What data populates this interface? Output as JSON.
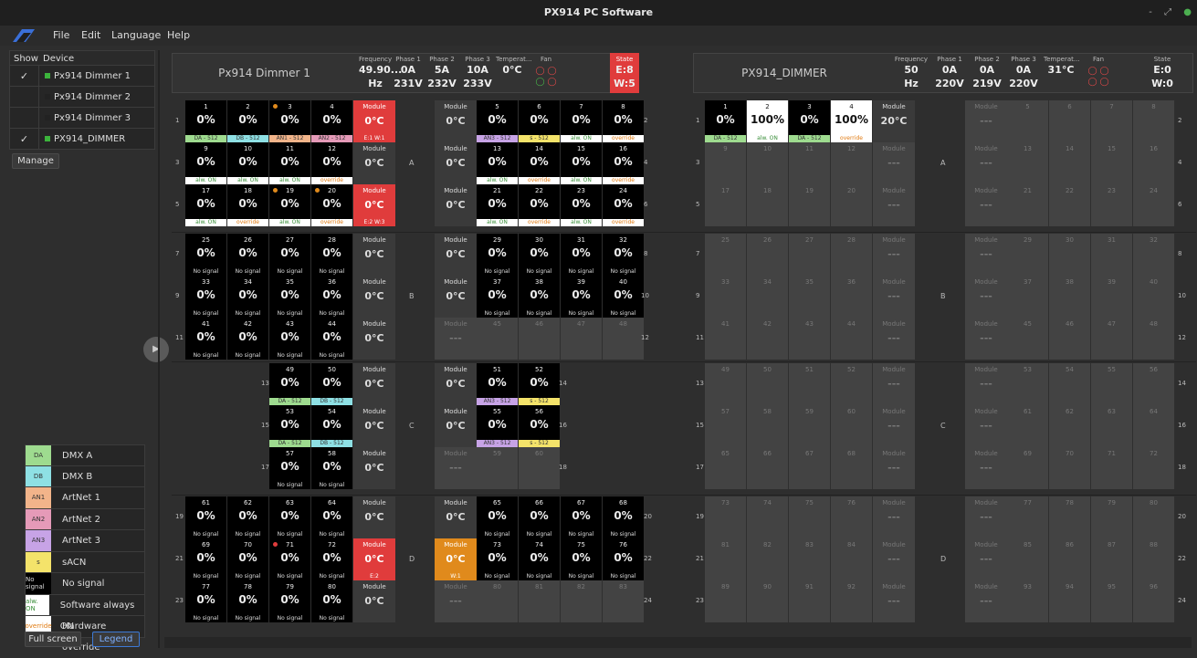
{
  "window": {
    "title": "PX914 PC Software",
    "controls": [
      "-",
      "⤢",
      "●"
    ]
  },
  "menu": [
    "File",
    "Edit",
    "Language",
    "Help"
  ],
  "devices": {
    "header_show": "Show",
    "header_device": "Device",
    "items": [
      {
        "checked": true,
        "name": "Px914 Dimmer 1",
        "color": "#3cb43c"
      },
      {
        "checked": false,
        "name": "Px914 Dimmer 2",
        "color": "#222222"
      },
      {
        "checked": false,
        "name": "Px914 Dimmer 3",
        "color": "#222222"
      },
      {
        "checked": true,
        "name": "PX914_DIMMER",
        "color": "#3cb43c"
      }
    ],
    "manage": "Manage"
  },
  "legend": [
    {
      "code": "DA",
      "label": "DMX A",
      "color": "#9edb8f",
      "text": "#333"
    },
    {
      "code": "DB",
      "label": "DMX B",
      "color": "#8ee0e4",
      "text": "#333"
    },
    {
      "code": "AN1",
      "label": "ArtNet 1",
      "color": "#f2b48a",
      "text": "#333"
    },
    {
      "code": "AN2",
      "label": "ArtNet 2",
      "color": "#e59ab8",
      "text": "#333"
    },
    {
      "code": "AN3",
      "label": "ArtNet 3",
      "color": "#c7a3e6",
      "text": "#333"
    },
    {
      "code": "s",
      "label": "sACN",
      "color": "#f4e36a",
      "text": "#333"
    },
    {
      "code": "No signal",
      "label": "No signal",
      "color": "#000000",
      "text": "#ddd"
    },
    {
      "code": "alw. ON",
      "label": "Software always ON",
      "color": "#ffffff",
      "text": "#3a8f3a"
    },
    {
      "code": "override",
      "label": "Hardware override",
      "color": "#ffffff",
      "text": "#e07a10"
    }
  ],
  "buttons": {
    "fullscreen": "Full screen",
    "legend": "Legend"
  },
  "tags": {
    "DA": {
      "text": "DA - 512",
      "bg": "#9edb8f",
      "fg": "#333"
    },
    "DB": {
      "text": "DB - 512",
      "bg": "#8ee0e4",
      "fg": "#333"
    },
    "AN1": {
      "text": "AN1 - 512",
      "bg": "#f2b48a",
      "fg": "#333"
    },
    "AN2": {
      "text": "AN2 - 512",
      "bg": "#e59ab8",
      "fg": "#333"
    },
    "AN3": {
      "text": "AN3 - 512",
      "bg": "#c7a3e6",
      "fg": "#333"
    },
    "S": {
      "text": "s - 512",
      "bg": "#f4e36a",
      "fg": "#333"
    },
    "ON": {
      "text": "alw. ON",
      "bg": "#ffffff",
      "fg": "#3a8f3a"
    },
    "OV": {
      "text": "override",
      "bg": "#ffffff",
      "fg": "#e07a10"
    },
    "NS": {
      "text": "No signal",
      "bg": "#000000",
      "fg": "#ddd"
    }
  },
  "header_labels": {
    "freq": "Frequency",
    "p1": "Phase 1",
    "p2": "Phase 2",
    "p3": "Phase 3",
    "temp": "Temperat...",
    "fan": "Fan",
    "state": "State"
  },
  "panels": [
    {
      "name": "Px914 Dimmer 1",
      "freq": [
        "49.90...",
        "Hz"
      ],
      "p1": [
        "0A",
        "231V"
      ],
      "p2": [
        "5A",
        "232V"
      ],
      "p3": [
        "10A",
        "233V"
      ],
      "temp": "0°C",
      "fan": [
        [
          "red",
          "red"
        ],
        [
          "green",
          "red"
        ]
      ],
      "state": [
        "E:8",
        "W:5"
      ],
      "state_fail": true
    },
    {
      "name": "PX914_DIMMER",
      "freq": [
        "50",
        "Hz"
      ],
      "p1": [
        "0A",
        "220V"
      ],
      "p2": [
        "0A",
        "219V"
      ],
      "p3": [
        "0A",
        "220V"
      ],
      "temp": "31°C",
      "fan": [
        [
          "red",
          "red"
        ],
        [
          "red",
          "red"
        ]
      ],
      "state": [
        "E:0",
        "W:0"
      ],
      "state_fail": false
    }
  ],
  "module_label": "Module",
  "placeholder": "---",
  "percent_zero": "0%",
  "percent_full": "100%",
  "temps": {
    "zero": "0°C",
    "twenty": "20°C"
  },
  "codes": {
    "e1w1": "E:1 W:1",
    "e2w3": "E:2 W:3",
    "e2": "E:2",
    "w1": "W:1"
  },
  "sections": [
    "A",
    "B",
    "C",
    "D"
  ]
}
